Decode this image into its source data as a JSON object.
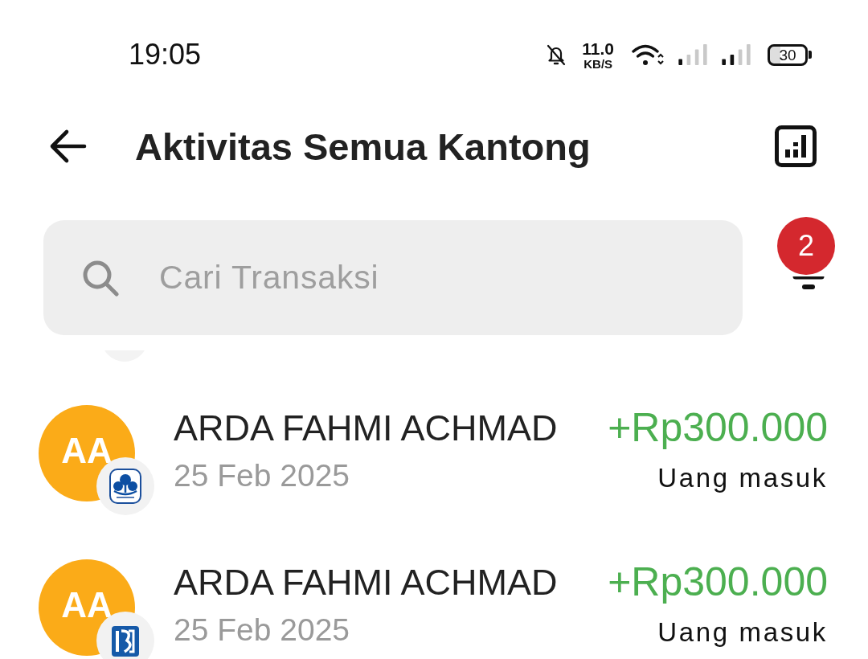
{
  "status_bar": {
    "time": "19:05",
    "network_speed": "11.0",
    "network_speed_unit": "KB/S",
    "battery": "30"
  },
  "header": {
    "title": "Aktivitas Semua Kantong"
  },
  "search": {
    "placeholder": "Cari Transaksi"
  },
  "filter": {
    "badge": "2"
  },
  "transactions": [
    {
      "kind": "flower",
      "initials": "AA",
      "name": "ARDA FAHMI ACHMAD",
      "date": "25 Feb 2025",
      "amount": "+Rp300.000",
      "incoming": true,
      "direction_label": "Uang masuk"
    },
    {
      "kind": "stripes",
      "initials": "AA",
      "name": "ARDA FAHMI ACHMAD",
      "date": "25 Feb 2025",
      "amount": "+Rp300.000",
      "incoming": true,
      "direction_label": "Uang masuk"
    }
  ]
}
